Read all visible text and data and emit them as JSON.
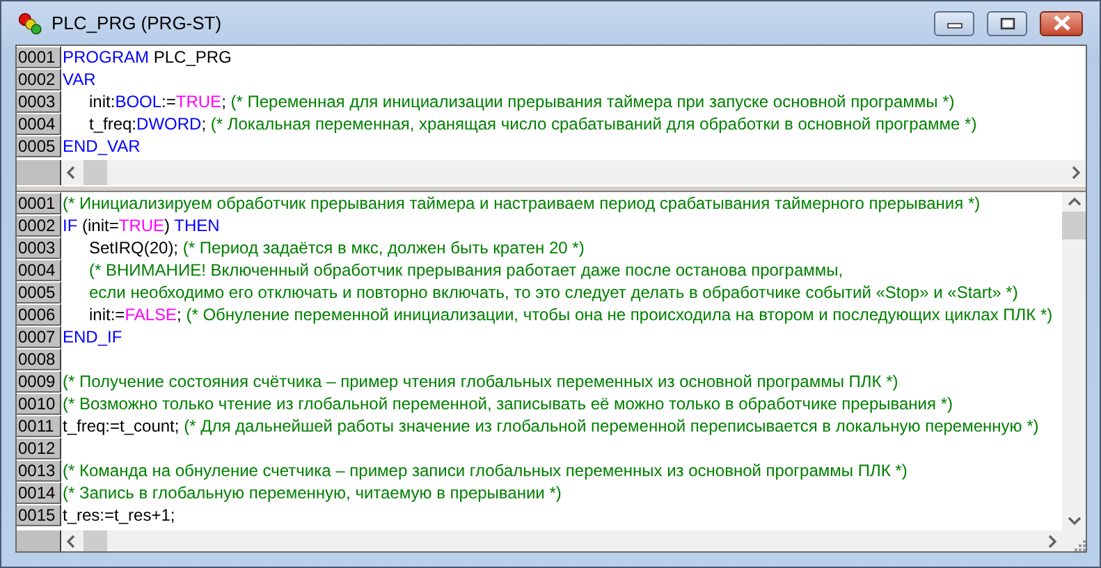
{
  "window": {
    "title": "PLC_PRG (PRG-ST)"
  },
  "panes": [
    {
      "lines": [
        {
          "number": "0001",
          "indented": false,
          "segments": [
            {
              "kind": "keyword",
              "text": "PROGRAM"
            },
            {
              "kind": "plain",
              "text": " PLC_PRG"
            }
          ]
        },
        {
          "number": "0002",
          "indented": false,
          "segments": [
            {
              "kind": "keyword",
              "text": "VAR"
            }
          ]
        },
        {
          "number": "0003",
          "indented": true,
          "segments": [
            {
              "kind": "plain",
              "text": "init:"
            },
            {
              "kind": "keyword",
              "text": "BOOL"
            },
            {
              "kind": "plain",
              "text": ":="
            },
            {
              "kind": "literal",
              "text": "TRUE"
            },
            {
              "kind": "plain",
              "text": ";"
            },
            {
              "kind": "comment",
              "text": " (* Переменная для инициализации прерывания таймера при запуске основной программы *)"
            }
          ]
        },
        {
          "number": "0004",
          "indented": true,
          "segments": [
            {
              "kind": "plain",
              "text": "t_freq:"
            },
            {
              "kind": "keyword",
              "text": "DWORD"
            },
            {
              "kind": "plain",
              "text": ";"
            },
            {
              "kind": "comment",
              "text": " (* Локальная переменная, хранящая число срабатываний для обработки в основной программе *)"
            }
          ]
        },
        {
          "number": "0005",
          "indented": false,
          "segments": [
            {
              "kind": "keyword",
              "text": "END_VAR"
            }
          ]
        }
      ]
    },
    {
      "lines": [
        {
          "number": "0001",
          "indented": false,
          "segments": [
            {
              "kind": "comment",
              "text": "(* Инициализируем обработчик прерывания таймера и настраиваем период срабатывания таймерного прерывания *)"
            }
          ]
        },
        {
          "number": "0002",
          "indented": false,
          "segments": [
            {
              "kind": "keyword",
              "text": "IF"
            },
            {
              "kind": "plain",
              "text": " (init="
            },
            {
              "kind": "literal",
              "text": "TRUE"
            },
            {
              "kind": "plain",
              "text": ") "
            },
            {
              "kind": "keyword",
              "text": "THEN"
            }
          ]
        },
        {
          "number": "0003",
          "indented": true,
          "segments": [
            {
              "kind": "plain",
              "text": "SetIRQ(20);"
            },
            {
              "kind": "comment",
              "text": " (* Период задаётся в мкс, должен быть кратен 20 *)"
            }
          ]
        },
        {
          "number": "0004",
          "indented": true,
          "segments": [
            {
              "kind": "comment",
              "text": "(* ВНИМАНИЕ! Включенный обработчик прерывания работает даже после останова программы,"
            }
          ]
        },
        {
          "number": "0005",
          "indented": true,
          "segments": [
            {
              "kind": "comment",
              "text": "если необходимо его отключать и повторно включать, то это следует делать в обработчике событий «Stop» и «Start» *)"
            }
          ]
        },
        {
          "number": "0006",
          "indented": true,
          "segments": [
            {
              "kind": "plain",
              "text": "init:="
            },
            {
              "kind": "literal",
              "text": "FALSE"
            },
            {
              "kind": "plain",
              "text": ";"
            },
            {
              "kind": "comment",
              "text": " (* Обнуление переменной инициализации, чтобы она не происходила на втором и последующих циклах ПЛК *)"
            }
          ]
        },
        {
          "number": "0007",
          "indented": false,
          "segments": [
            {
              "kind": "keyword",
              "text": "END_IF"
            }
          ]
        },
        {
          "number": "0008"
        },
        {
          "number": "0009",
          "indented": false,
          "segments": [
            {
              "kind": "comment",
              "text": "(* Получение состояния счётчика – пример чтения глобальных переменных из основной программы ПЛК *)"
            }
          ]
        },
        {
          "number": "0010",
          "indented": false,
          "segments": [
            {
              "kind": "comment",
              "text": "(* Возможно только чтение из глобальной переменной, записывать её можно только в обработчике прерывания *)"
            }
          ]
        },
        {
          "number": "0011",
          "indented": false,
          "segments": [
            {
              "kind": "plain",
              "text": "t_freq:=t_count;"
            },
            {
              "kind": "comment",
              "text": " (* Для дальнейшей работы значение из глобальной переменной переписывается в локальную переменную *)"
            }
          ]
        },
        {
          "number": "0012"
        },
        {
          "number": "0013",
          "indented": false,
          "segments": [
            {
              "kind": "comment",
              "text": "(* Команда на обнуление счетчика – пример записи глобальных переменных из основной программы ПЛК *)"
            }
          ]
        },
        {
          "number": "0014",
          "indented": false,
          "segments": [
            {
              "kind": "comment",
              "text": "(* Запись в глобальную переменную, читаемую в прерывании *)"
            }
          ]
        },
        {
          "number": "0015",
          "indented": false,
          "segments": [
            {
              "kind": "plain",
              "text": "t_res:=t_res+1;"
            }
          ]
        }
      ]
    }
  ]
}
